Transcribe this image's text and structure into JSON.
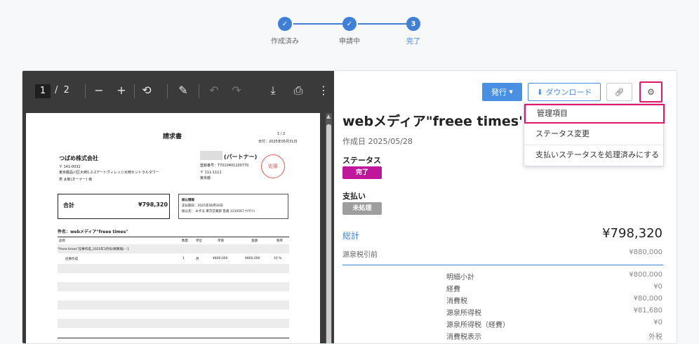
{
  "stepper": {
    "steps": [
      {
        "label": "作成済み",
        "state": "done"
      },
      {
        "label": "申請中",
        "state": "done"
      },
      {
        "label": "完了",
        "state": "current",
        "number": "3"
      }
    ]
  },
  "viewer": {
    "page_current": "1",
    "page_sep": "/",
    "page_total": "2"
  },
  "doc": {
    "title": "請求書",
    "page": "1 / 2",
    "date": "日付：2025年05月31日",
    "client": "つばめ株式会社",
    "client_zip": "〒 141-0032",
    "client_addr": "東京都品川区大崎1-2-2アートヴィレッジ大崎セントラルタワー",
    "client_contact": "表 太郎(オーナー) 様",
    "partner": "(パートナー)",
    "reg_no": "登録番号：T7010401100770",
    "partner_zip": "〒 111-1111",
    "partner_addr": "東京都",
    "seal": "佐藤",
    "total_label": "合計",
    "total_value": "¥798,320",
    "pay_title": "振込情報",
    "pay_due": "支払期日：2025年06月30日",
    "pay_to": "振込先：  みずほ 東京営業部 普通 1234567 ｻﾄｳｱｲｺ",
    "subject": "件名：webメディア\"freee times\"",
    "cols": [
      "品目",
      "数量",
      "単位",
      "単価",
      "金額",
      "税率"
    ],
    "group": "\"freee times\"記事作成_2025年3月号(精算報) - 1",
    "item": {
      "name": "記事作成",
      "qty": "1",
      "unit": "月",
      "price": "¥800,000",
      "amount": "¥800,000",
      "tax": "10 %"
    }
  },
  "actions": {
    "issue": "発行",
    "download": "ダウンロード"
  },
  "menu": {
    "items": [
      "管理項目",
      "ステータス変更",
      "支払いステータスを処理済みにする"
    ]
  },
  "invoice": {
    "title": "webメディア\"freee times\"",
    "created": "作成日 2025/05/28",
    "status_label": "ステータス",
    "status_badge": "完了",
    "payment_label": "支払い",
    "payment_badge": "未処理",
    "total_label": "総計",
    "total_value": "¥798,320",
    "withholding_label": "源泉税引前",
    "withholding_value": "¥880,000",
    "breakdown": [
      {
        "label": "明細小計",
        "value": "¥800,000"
      },
      {
        "label": "経費",
        "value": "¥0"
      },
      {
        "label": "消費税",
        "value": "¥80,000"
      },
      {
        "label": "源泉所得税",
        "value": "¥81,680"
      },
      {
        "label": "源泉所得税（経費）",
        "value": "¥0"
      },
      {
        "label": "消費税表示",
        "value": "外税"
      }
    ]
  },
  "colors": {
    "accent": "#3f7fd6",
    "highlight": "#e0176a",
    "status_badge": "#c0169c",
    "payment_badge": "#9e9e9e",
    "issue_button": "#4a90e2"
  }
}
